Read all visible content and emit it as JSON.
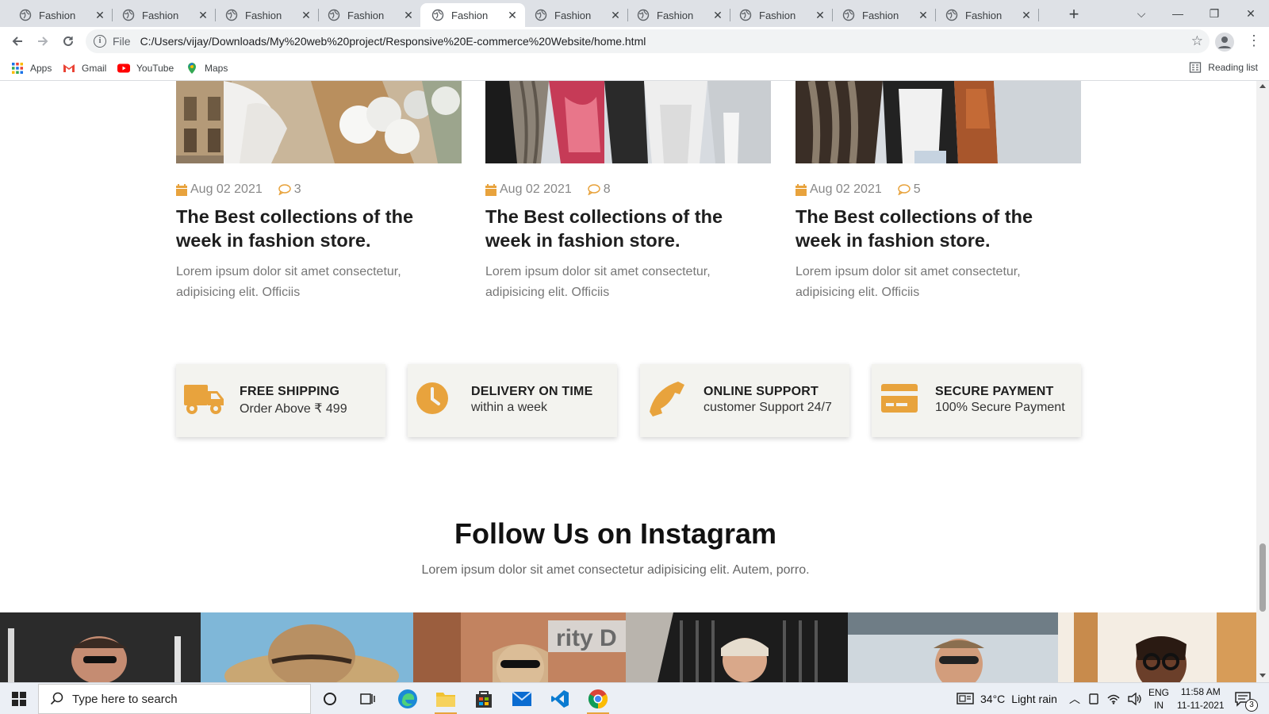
{
  "browser": {
    "tabs": [
      {
        "title": "Fashion"
      },
      {
        "title": "Fashion"
      },
      {
        "title": "Fashion"
      },
      {
        "title": "Fashion"
      },
      {
        "title": "Fashion",
        "active": true
      },
      {
        "title": "Fashion"
      },
      {
        "title": "Fashion"
      },
      {
        "title": "Fashion"
      },
      {
        "title": "Fashion"
      },
      {
        "title": "Fashion"
      }
    ],
    "omnibox": {
      "scheme_label": "File",
      "url": "C:/Users/vijay/Downloads/My%20web%20project/Responsive%20E-commerce%20Website/home.html"
    },
    "bookmarks": [
      {
        "label": "Apps",
        "icon": "apps-grid-icon"
      },
      {
        "label": "Gmail",
        "icon": "gmail-icon"
      },
      {
        "label": "YouTube",
        "icon": "youtube-icon"
      },
      {
        "label": "Maps",
        "icon": "maps-icon"
      }
    ],
    "reading_list": "Reading list"
  },
  "blog": {
    "posts": [
      {
        "date": "Aug 02 2021",
        "comments": "3",
        "title": "The Best collections of the week in fashion store.",
        "text": "Lorem ipsum dolor sit amet consectetur, adipisicing elit. Officiis"
      },
      {
        "date": "Aug 02 2021",
        "comments": "8",
        "title": "The Best collections of the week in fashion store.",
        "text": "Lorem ipsum dolor sit amet consectetur, adipisicing elit. Officiis"
      },
      {
        "date": "Aug 02 2021",
        "comments": "5",
        "title": "The Best collections of the week in fashion store.",
        "text": "Lorem ipsum dolor sit amet consectetur, adipisicing elit. Officiis"
      }
    ]
  },
  "features": [
    {
      "title": "FREE SHIPPING",
      "subtitle": "Order Above ₹ 499",
      "icon": "truck-icon"
    },
    {
      "title": "DELIVERY ON TIME",
      "subtitle": "within a week",
      "icon": "clock-icon"
    },
    {
      "title": "ONLINE SUPPORT",
      "subtitle": "customer Support 24/7",
      "icon": "phone-icon"
    },
    {
      "title": "SECURE PAYMENT",
      "subtitle": "100% Secure Payment",
      "icon": "credit-card-icon"
    }
  ],
  "instagram": {
    "title": "Follow Us on Instagram",
    "subtitle": "Lorem ipsum dolor sit amet consectetur adipisicing elit. Autem, porro."
  },
  "taskbar": {
    "search_placeholder": "Type here to search",
    "weather": {
      "temp": "34°C",
      "condition": "Light rain"
    },
    "language": {
      "lang": "ENG",
      "region": "IN"
    },
    "clock": {
      "time": "11:58 AM",
      "date": "11-11-2021"
    },
    "notifications": "3"
  },
  "colors": {
    "accent": "#e8a33d",
    "feature_bg": "#f3f3ef"
  }
}
